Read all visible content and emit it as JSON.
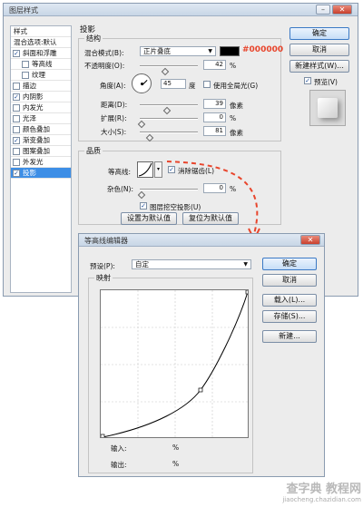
{
  "layer_style": {
    "title": "图层样式",
    "close_glyph": "✕",
    "min_glyph": "–",
    "styles_header": "样式",
    "blend_options": "混合选项:默认",
    "sidebar": [
      {
        "label": "斜面和浮雕",
        "checked": true
      },
      {
        "label": "等高线",
        "checked": false,
        "indent": true
      },
      {
        "label": "纹理",
        "checked": false,
        "indent": true
      },
      {
        "label": "描边",
        "checked": false
      },
      {
        "label": "内阴影",
        "checked": true
      },
      {
        "label": "内发光",
        "checked": false
      },
      {
        "label": "光泽",
        "checked": false
      },
      {
        "label": "颜色叠加",
        "checked": false
      },
      {
        "label": "渐变叠加",
        "checked": true
      },
      {
        "label": "图案叠加",
        "checked": false
      },
      {
        "label": "外发光",
        "checked": false
      },
      {
        "label": "投影",
        "checked": true,
        "selected": true
      }
    ],
    "section_title": "投影",
    "structure_title": "结构",
    "blend_mode_label": "混合模式(B):",
    "blend_mode_value": "正片叠底",
    "color_hex": "#000000",
    "opacity_label": "不透明度(O):",
    "opacity_value": "42",
    "percent": "%",
    "angle_label": "角度(A):",
    "angle_value": "45",
    "degree": "度",
    "global_light_label": "使用全局光(G)",
    "distance_label": "距离(D):",
    "distance_value": "39",
    "spread_label": "扩展(R):",
    "spread_value": "0",
    "size_label": "大小(S):",
    "size_value": "81",
    "px": "像素",
    "quality_title": "品质",
    "contour_label": "等高线:",
    "antialias_label": "消除锯齿(L)",
    "noise_label": "杂色(N):",
    "noise_value": "0",
    "knockout_label": "图层挖空投影(U)",
    "make_default": "设置为默认值",
    "reset_default": "复位为默认值",
    "ok": "确定",
    "cancel": "取消",
    "new_style": "新建样式(W)...",
    "preview_label": "预览(V)"
  },
  "contour_editor": {
    "title": "等高线编辑器",
    "preset_label": "预设(P):",
    "preset_value": "自定",
    "mapping_title": "映射",
    "input_label": "输入:",
    "output_label": "输出:",
    "percent": "%",
    "ok": "确定",
    "cancel": "取消",
    "load": "载入(L)...",
    "save": "存储(S)...",
    "new": "新建..."
  },
  "watermark": {
    "line1": "查字典 教程网",
    "line2": "jiaocheng.chazidian.com"
  },
  "colors": {
    "accent_red": "#e8452c",
    "selection_blue": "#3d8ee6"
  }
}
